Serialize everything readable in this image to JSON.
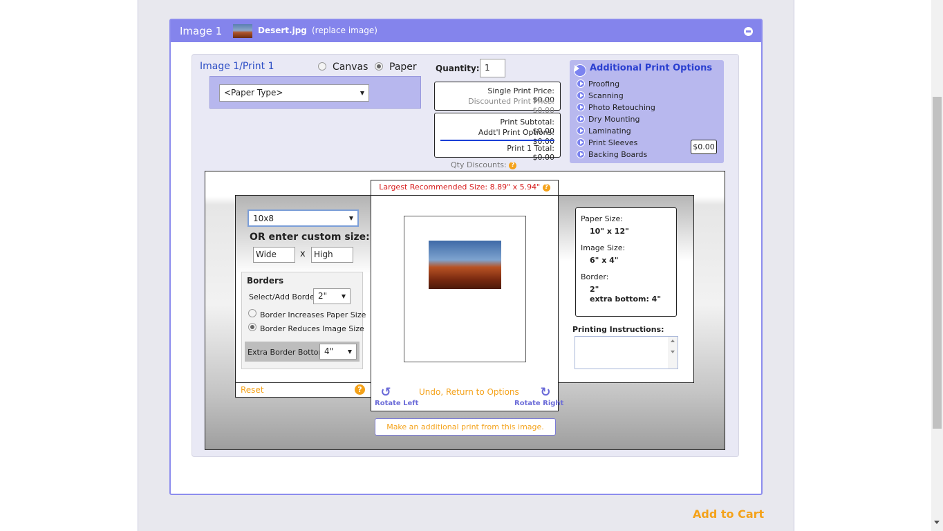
{
  "header": {
    "image_title": "Image 1",
    "file_name": "Desert.jpg",
    "replace_link": "(replace image)"
  },
  "print": {
    "title": "Image 1/Print 1",
    "media_options": [
      {
        "label": "Canvas",
        "checked": false
      },
      {
        "label": "Paper",
        "checked": true
      }
    ],
    "paper_type": "<Paper Type>"
  },
  "quantity": {
    "label": "Quantity:",
    "value": "1"
  },
  "pricing": {
    "single_price_label": "Single Print Price:",
    "single_price": "$0.00",
    "discounted_label": "Discounted Print Price:",
    "discounted_price": "$0.00",
    "subtotal_label": "Print Subtotal:",
    "subtotal": "$0.00",
    "addl_options_label": "Addt'l Print Options:",
    "addl_options": "$0.00",
    "total_label": "Print 1 Total:",
    "total": "$0.00",
    "qty_discounts": "Qty Discounts:"
  },
  "additional_options": {
    "title": "Additional Print Options",
    "items": [
      "Proofing",
      "Scanning",
      "Photo Retouching",
      "Dry Mounting",
      "Laminating",
      "Print Sleeves",
      "Backing Boards"
    ],
    "total": "$0.00"
  },
  "size": {
    "largest_recommended": "Largest Recommended Size:  8.89\" x 5.94\"",
    "selected": "10x8",
    "custom_label": "OR  enter custom size:",
    "wide_placeholder": "Wide",
    "high_placeholder": "High",
    "separator": "x"
  },
  "borders": {
    "title": "Borders",
    "select_label": "Select/Add Border:",
    "select_value": "2\"",
    "option_increase": "Border Increases Paper Size",
    "option_reduce": "Border Reduces Image Size",
    "extra_label": "Extra Border Bottom:",
    "extra_value": "4\""
  },
  "controls": {
    "reset": "Reset",
    "undo": "Undo, Return to Options",
    "rotate_left": "Rotate Left",
    "rotate_right": "Rotate Right",
    "make_additional": "Make an additional print from this image."
  },
  "info": {
    "paper_size_label": "Paper Size:",
    "paper_size": "10\" x 12\"",
    "image_size_label": "Image Size:",
    "image_size": "6\" x 4\"",
    "border_label": "Border:",
    "border": "2\"",
    "extra_bottom": "extra bottom: 4\""
  },
  "instructions": {
    "label": "Printing Instructions:"
  },
  "cart": {
    "label": "Add to Cart"
  },
  "colors": {
    "header": "#8484ec",
    "accent_orange": "#f4a21a",
    "link_blue": "#2a4cc4",
    "warning_red": "#d61a1a"
  }
}
